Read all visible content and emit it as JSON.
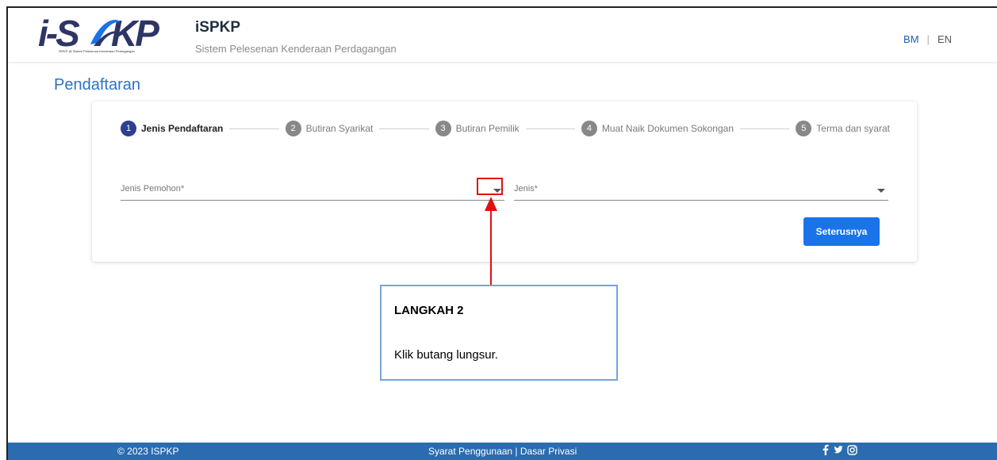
{
  "header": {
    "app_title": "iSPKP",
    "app_subtitle": "Sistem Pelesenan Kenderaan Perdagangan",
    "logo_text": "i-SPKP",
    "logo_caption": "iSPKP @ Sistem Pelesenan Kenderaan Perdagangan",
    "lang_bm": "BM",
    "lang_sep": "|",
    "lang_en": "EN"
  },
  "page": {
    "title": "Pendaftaran"
  },
  "stepper": {
    "steps": [
      {
        "num": "1",
        "label": "Jenis Pendaftaran",
        "active": true
      },
      {
        "num": "2",
        "label": "Butiran Syarikat",
        "active": false
      },
      {
        "num": "3",
        "label": "Butiran Pemilik",
        "active": false
      },
      {
        "num": "4",
        "label": "Muat Naik Dokumen Sokongan",
        "active": false
      },
      {
        "num": "5",
        "label": "Terma dan syarat",
        "active": false
      }
    ]
  },
  "form": {
    "jenis_pemohon_placeholder": "Jenis Pemohon*",
    "jenis_placeholder": "Jenis*",
    "next_button": "Seterusnya"
  },
  "annotation": {
    "heading": "LANGKAH 2",
    "text": "Klik butang lungsur.",
    "color": "#e01010"
  },
  "footer": {
    "copyright": "© 2023 ISPKP",
    "link_terms": "Syarat Penggunaan",
    "link_sep": " | ",
    "link_privacy": "Dasar Privasi",
    "social_icons": [
      "facebook-icon",
      "twitter-icon",
      "instagram-icon"
    ]
  },
  "colors": {
    "accent": "#1a73e8",
    "footer": "#2b6cb0",
    "step_active": "#2e3f8f",
    "title": "#2a73c8"
  }
}
